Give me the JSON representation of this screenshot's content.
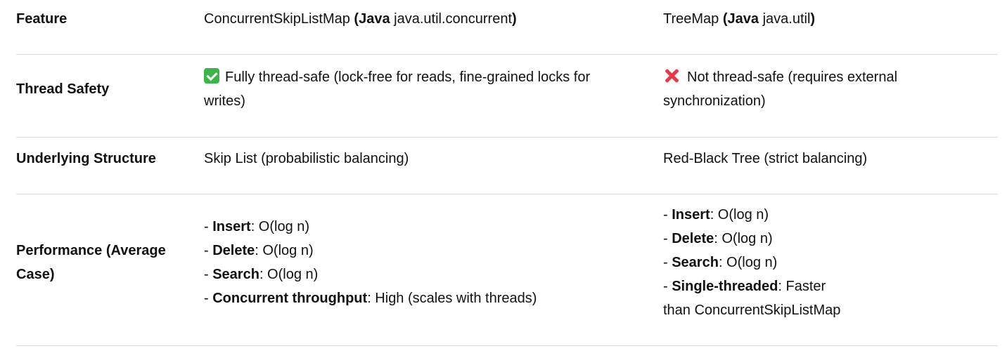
{
  "table": {
    "header": {
      "feature": "Feature",
      "col2": {
        "name": "ConcurrentSkipListMap",
        "open": " (",
        "lang": "Java",
        "pkg": " java.util.concurrent",
        "close": ")"
      },
      "col3": {
        "name": "TreeMap",
        "open": " (",
        "lang": "Java",
        "pkg": " java.util",
        "close": ")"
      }
    },
    "thread_safety": {
      "label": "Thread Safety",
      "col2_icon": "check-icon",
      "col2_line1": "Fully thread-safe (lock-free for reads, fine-grained locks for",
      "col2_line2": "writes)",
      "col3_icon": "cross-icon",
      "col3_line1": "Not thread-safe (requires external",
      "col3_line2": "synchronization)"
    },
    "structure": {
      "label": "Underlying Structure",
      "col2": "Skip List (probabilistic balancing)",
      "col3": "Red-Black Tree (strict balancing)"
    },
    "performance": {
      "label_line1": "Performance (Average",
      "label_line2": "Case)",
      "col2": [
        {
          "prefix": "- ",
          "key": "Insert",
          "value": ": O(log n)"
        },
        {
          "prefix": "- ",
          "key": "Delete",
          "value": ": O(log n)"
        },
        {
          "prefix": "- ",
          "key": "Search",
          "value": ": O(log n)"
        },
        {
          "prefix": "- ",
          "key": "Concurrent throughput",
          "value": ": High (scales with threads)"
        }
      ],
      "col3": [
        {
          "prefix": "- ",
          "key": "Insert",
          "value": ": O(log n)"
        },
        {
          "prefix": "- ",
          "key": "Delete",
          "value": ": O(log n)"
        },
        {
          "prefix": "- ",
          "key": "Search",
          "value": ": O(log n)"
        },
        {
          "prefix": "- ",
          "key": "Single-threaded",
          "value": ": Faster"
        }
      ],
      "col3_tail": "than ConcurrentSkipListMap"
    }
  }
}
